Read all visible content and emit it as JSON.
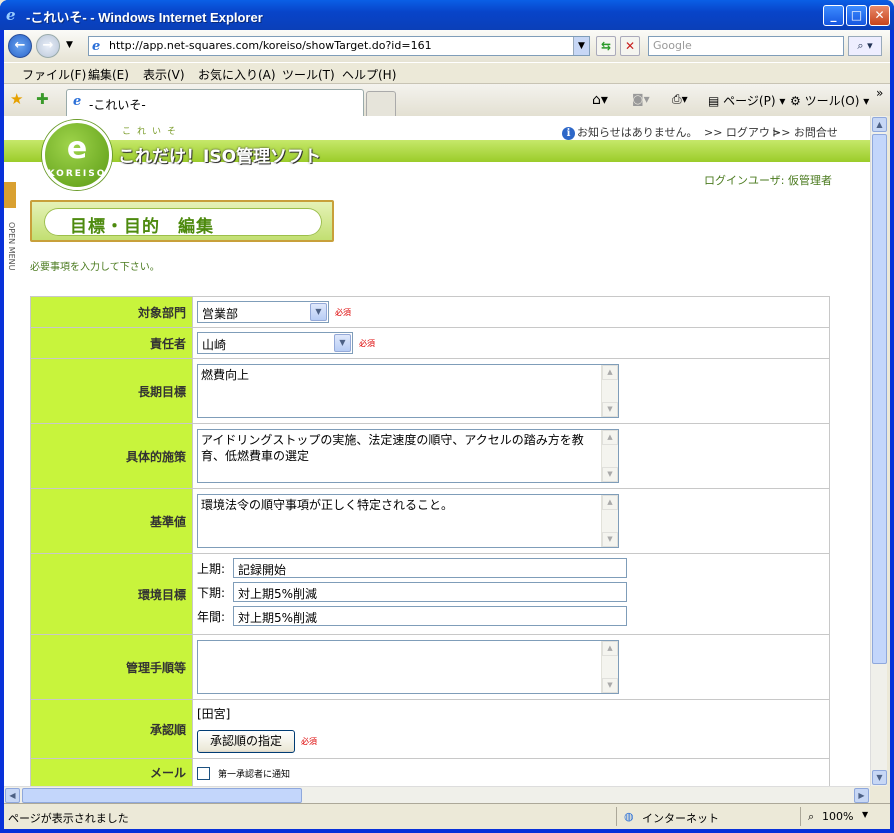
{
  "window": {
    "title": "-これいそ- - Windows Internet Explorer"
  },
  "address": {
    "url": "http://app.net-squares.com/koreiso/showTarget.do?id=161",
    "search_placeholder": "Google"
  },
  "menu": [
    "ファイル(F)",
    "編集(E)",
    "表示(V)",
    "お気に入り(A)",
    "ツール(T)",
    "ヘルプ(H)"
  ],
  "tab": {
    "label": "-これいそ-"
  },
  "commands": {
    "page": "ページ(P)",
    "tools": "ツール(O)"
  },
  "site": {
    "brand_small": "これいそ",
    "brand": "これだけ！ISO管理ソフト",
    "logo_letter": "e",
    "logo_text": "KOREISO",
    "notice": "お知らせはありません。",
    "logout": ">> ログアウト",
    "contact": ">> お問合せ",
    "login_user": "ログインユーザ: 仮管理者",
    "side_menu": "OPEN MENU"
  },
  "page": {
    "title": "目標・目的　編集",
    "instruction": "必要事項を入力して下さい。"
  },
  "form": {
    "dept_label": "対象部門",
    "dept_value": "営業部",
    "owner_label": "責任者",
    "owner_value": "山崎",
    "required": "必須",
    "longterm_label": "長期目標",
    "longterm_value": "燃費向上",
    "measures_label": "具体的施策",
    "measures_value": "アイドリングストップの実施、法定速度の順守、アクセルの踏み方を教育、低燃費車の選定",
    "standard_label": "基準値",
    "standard_value": "環境法令の順守事項が正しく特定されること。",
    "env_label": "環境目標",
    "first_half_label": "上期:",
    "first_half_value": "記録開始",
    "second_half_label": "下期:",
    "second_half_value": "対上期5%削減",
    "annual_label": "年間:",
    "annual_value": "対上期5%削減",
    "procedure_label": "管理手順等",
    "procedure_value": "",
    "approval_label": "承認順",
    "approval_value": "[田宮]",
    "approval_button": "承認順の指定",
    "mail_label": "メール",
    "mail_option": "第一承認者に通知"
  },
  "status": {
    "text": "ページが表示されました",
    "zone": "インターネット",
    "zoom": "100%"
  }
}
